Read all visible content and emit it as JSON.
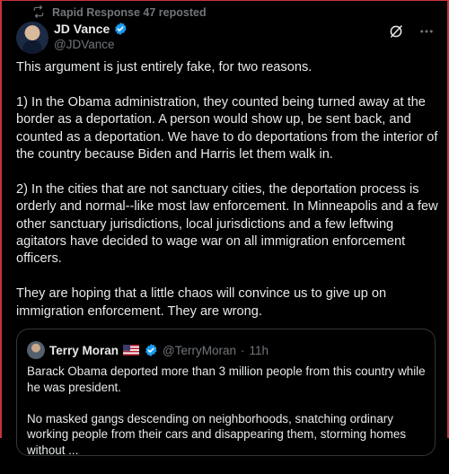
{
  "repost": {
    "text": "Rapid Response 47 reposted"
  },
  "author": {
    "name": "JD Vance",
    "handle": "@JDVance"
  },
  "tweet": {
    "paragraphs": [
      "This argument is just entirely fake, for two reasons.",
      "1) In the Obama administration, they counted being turned away at the border as a deportation. A person would show up, be sent back, and counted as a deportation. We have to do deportations from the interior of the country because Biden and Harris let them walk in.",
      "2) In the cities that are not sanctuary cities, the deportation process is orderly and normal--like most law enforcement. In Minneapolis and a few other sanctuary jurisdictions, local jurisdictions and a few leftwing agitators have decided to wage war on all immigration enforcement officers.",
      "They are hoping that a little chaos will convince us to give up on immigration enforcement. They are wrong."
    ]
  },
  "quote": {
    "name": "Terry Moran",
    "handle": "@TerryMoran",
    "separator": "·",
    "time": "11h",
    "paragraphs": [
      "Barack Obama deported more than 3 million people from this country while he was president.",
      "No masked gangs descending on neighborhoods, snatching ordinary working people from their cars and disappearing them, storming homes without ..."
    ]
  },
  "colors": {
    "background": "#000000",
    "text": "#e7e9ea",
    "muted": "#71767b",
    "verified": "#1d9bf0",
    "border": "#333639",
    "frame": "#c8323c"
  },
  "icons": [
    "repost-icon",
    "verified-badge-icon",
    "grok-icon",
    "more-icon",
    "us-flag-icon"
  ]
}
